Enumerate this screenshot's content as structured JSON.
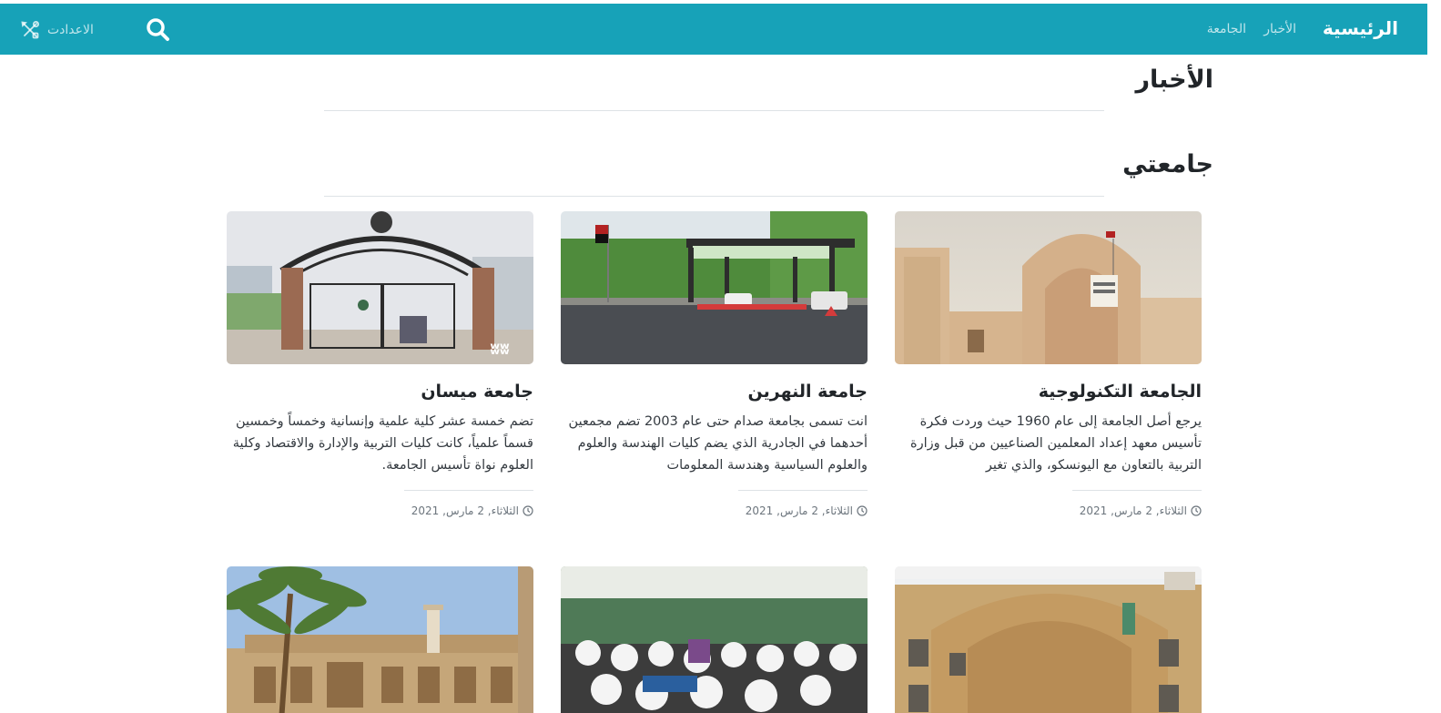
{
  "navbar": {
    "brand": "الرئيسية",
    "links": [
      "الأخبار",
      "الجامعة"
    ],
    "settings_label": "الاعدادت",
    "search_icon": "search-icon",
    "settings_icon": "tools-icon",
    "background": "#17a2b8"
  },
  "sections": {
    "news_title": "الأخبار",
    "university_title": "جامعتي"
  },
  "cards": [
    {
      "title": "الجامعة التكنولوجية",
      "text": "يرجع أصل الجامعة إلى عام 1960 حيث وردت فكرة تأسيس معهد إعداد المعلمين الصناعيين من قبل وزارة التربية بالتعاون مع اليونسكو، والذي تغير",
      "date": "الثلاثاء, 2 مارس, 2021"
    },
    {
      "title": "جامعة النهرين",
      "text": "انت تسمى بجامعة صدام حتى عام 2003 تضم مجمعين أحدهما في الجادرية الذي يضم كليات الهندسة والعلوم والعلوم السياسية وهندسة المعلومات",
      "date": "الثلاثاء, 2 مارس, 2021"
    },
    {
      "title": "جامعة ميسان",
      "text": "تضم خمسة عشر كلية علمية وإنسانية وخمساً وخمسين قسماً علمياً، كانت كليات التربية والإدارة والاقتصاد وكلية العلوم نواة تأسيس الجامعة.",
      "date": "الثلاثاء, 2 مارس, 2021"
    }
  ]
}
